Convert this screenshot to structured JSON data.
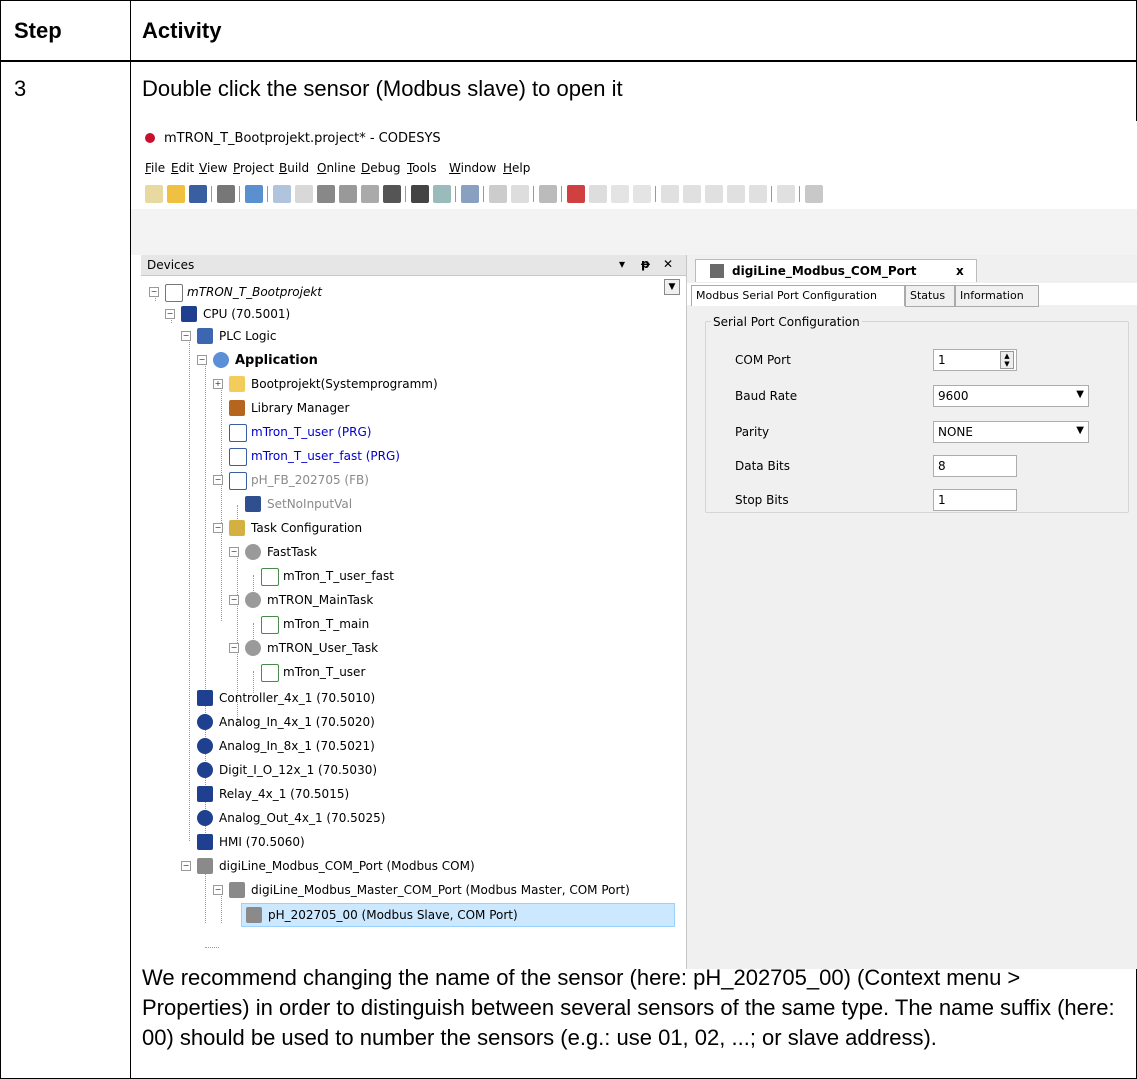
{
  "table": {
    "header_step": "Step",
    "header_activity": "Activity",
    "step_number": "3",
    "instruction": "Double click the sensor (Modbus slave) to open it",
    "note": "We recommend changing the name of the sensor (here: pH_202705_00) (Context menu > Properties) in order to distinguish between several sensors of the same type. The name suffix (here: 00) should be used to number the sensors (e.g.: use 01, 02, ...; or slave address)."
  },
  "window": {
    "title": "mTRON_T_Bootprojekt.project* - CODESYS"
  },
  "menu": [
    "File",
    "Edit",
    "View",
    "Project",
    "Build",
    "Online",
    "Debug",
    "Tools",
    "Window",
    "Help"
  ],
  "devices_panel": {
    "title": "Devices",
    "pin": "ᵽ",
    "close": "✕",
    "tree": [
      {
        "label": "mTRON_T_Bootprojekt",
        "icon": "project-icon"
      },
      {
        "label": "CPU (70.5001)",
        "icon": "cpu-icon"
      },
      {
        "label": "PLC Logic",
        "icon": "plc-logic-icon"
      },
      {
        "label": "Application",
        "icon": "application-gear-icon"
      },
      {
        "label": "Bootprojekt(Systemprogramm)",
        "icon": "folder-icon"
      },
      {
        "label": "Library Manager",
        "icon": "library-icon"
      },
      {
        "label": "mTron_T_user (PRG)",
        "icon": "program-icon"
      },
      {
        "label": "mTron_T_user_fast (PRG)",
        "icon": "program-icon"
      },
      {
        "label": "pH_FB_202705 (FB)",
        "icon": "function-block-icon"
      },
      {
        "label": "SetNoInputVal",
        "icon": "method-icon"
      },
      {
        "label": "Task Configuration",
        "icon": "task-config-icon"
      },
      {
        "label": "FastTask",
        "icon": "task-icon"
      },
      {
        "label": "mTron_T_user_fast",
        "icon": "program-call-icon"
      },
      {
        "label": "mTRON_MainTask",
        "icon": "task-icon"
      },
      {
        "label": "mTron_T_main",
        "icon": "program-call-icon"
      },
      {
        "label": "mTRON_User_Task",
        "icon": "task-icon"
      },
      {
        "label": "mTron_T_user",
        "icon": "program-call-icon"
      },
      {
        "label": "Controller_4x_1 (70.5010)",
        "icon": "controller-module-icon"
      },
      {
        "label": "Analog_In_4x_1 (70.5020)",
        "icon": "analog-in-module-icon"
      },
      {
        "label": "Analog_In_8x_1 (70.5021)",
        "icon": "analog-in-module-icon"
      },
      {
        "label": "Digit_I_O_12x_1 (70.5030)",
        "icon": "digital-io-module-icon"
      },
      {
        "label": "Relay_4x_1 (70.5015)",
        "icon": "relay-module-icon"
      },
      {
        "label": "Analog_Out_4x_1 (70.5025)",
        "icon": "analog-out-module-icon"
      },
      {
        "label": "HMI (70.5060)",
        "icon": "hmi-icon"
      },
      {
        "label": "digiLine_Modbus_COM_Port (Modbus COM)",
        "icon": "modbus-device-icon"
      },
      {
        "label": "digiLine_Modbus_Master_COM_Port (Modbus Master, COM Port)",
        "icon": "modbus-device-icon"
      },
      {
        "label": "pH_202705_00 (Modbus Slave, COM Port)",
        "icon": "modbus-device-icon"
      }
    ]
  },
  "editor": {
    "tab_label": "digiLine_Modbus_COM_Port",
    "tab_close": "x",
    "subtabs": [
      "Modbus Serial Port Configuration",
      "Status",
      "Information"
    ],
    "group_title": "Serial Port Configuration",
    "fields": [
      {
        "label": "COM Port",
        "value": "1"
      },
      {
        "label": "Baud Rate",
        "value": "9600"
      },
      {
        "label": "Parity",
        "value": "NONE"
      },
      {
        "label": "Data Bits",
        "value": "8"
      },
      {
        "label": "Stop Bits",
        "value": "1"
      }
    ]
  },
  "colors": {
    "link_blue": "#0000cc",
    "gray_text": "#8a8a8a",
    "selection": "#cce8ff"
  }
}
